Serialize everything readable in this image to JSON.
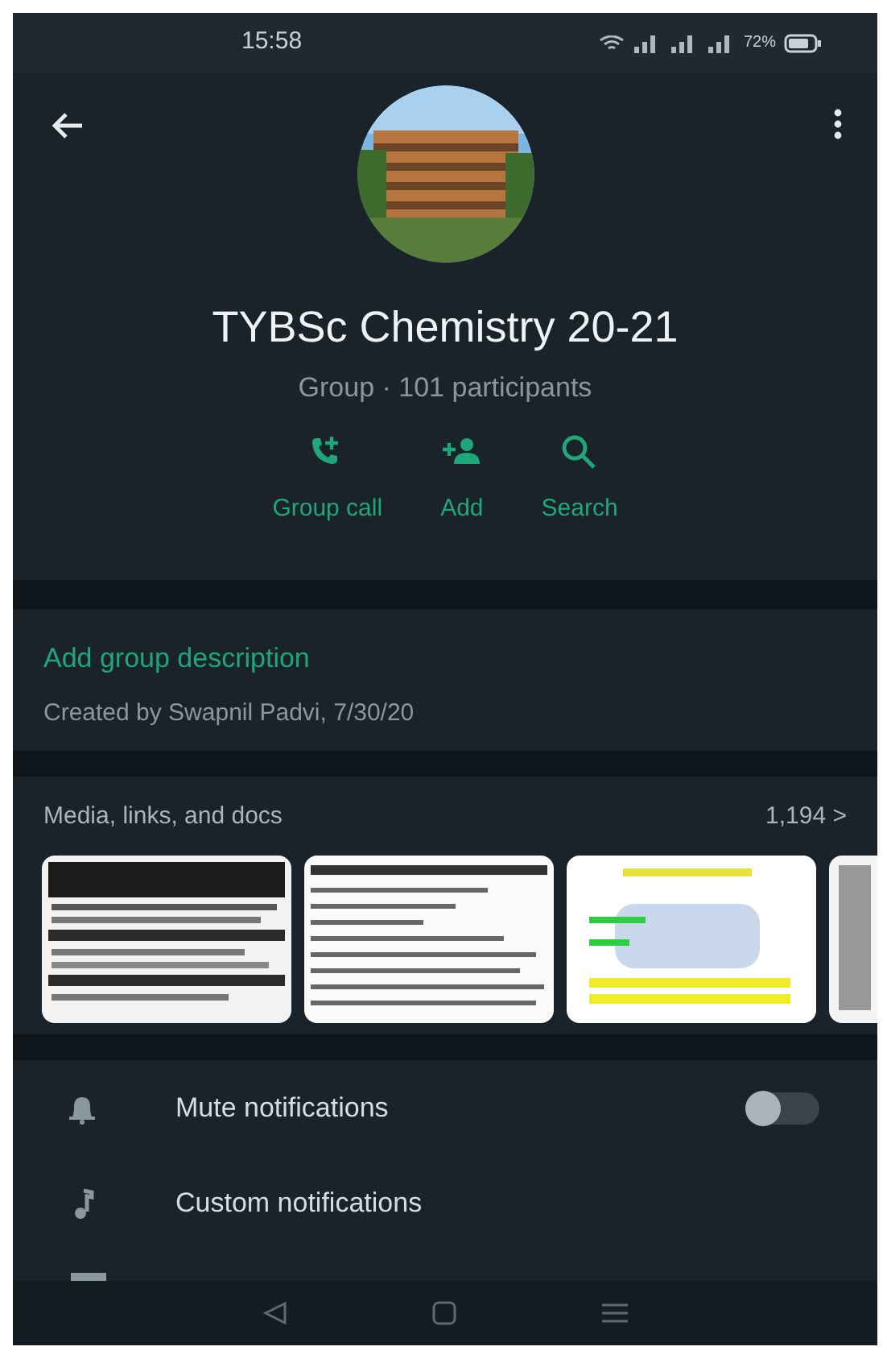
{
  "status_bar": {
    "time": "15:58",
    "battery": "72%"
  },
  "group": {
    "name": "TYBSc Chemistry 20-21",
    "subtitle": "Group · 101 participants"
  },
  "actions": [
    {
      "kind": "call",
      "label": "Group call"
    },
    {
      "kind": "add",
      "label": "Add"
    },
    {
      "kind": "search",
      "label": "Search"
    }
  ],
  "description": {
    "link": "Add group description",
    "created": "Created by Swapnil Padvi, 7/30/20"
  },
  "media": {
    "title": "Media, links, and docs",
    "count": "1,194 >"
  },
  "settings": [
    {
      "kind": "toggle",
      "label": "Mute notifications",
      "on": false
    },
    {
      "kind": "plain",
      "label": "Custom notifications"
    }
  ]
}
